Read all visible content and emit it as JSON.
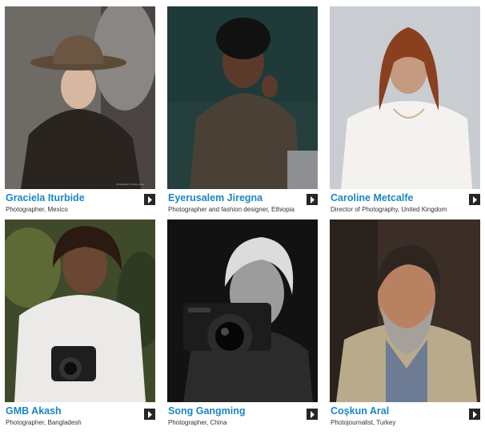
{
  "cards": [
    {
      "name": "Graciela Iturbide",
      "role": "Photographer, Mexico",
      "credit": "Photograph by Rene Arau"
    },
    {
      "name": "Eyerusalem Jiregna",
      "role": "Photographer and fashion designer, Ethiopia"
    },
    {
      "name": "Caroline Metcalfe",
      "role": "Director of Photography, United Kingdom"
    },
    {
      "name": "GMB Akash",
      "role": "Photographer, Bangladesh"
    },
    {
      "name": "Song Gangming",
      "role": "Photographer, China"
    },
    {
      "name": "Coşkun Aral",
      "role": "Photojournalist, Turkey"
    }
  ],
  "colors": {
    "link": "#1a87c2",
    "arrow_bg": "#262626",
    "role_text": "#333333"
  },
  "icons": {
    "arrow": "chevron-right-icon",
    "camera": "camera-icon"
  }
}
